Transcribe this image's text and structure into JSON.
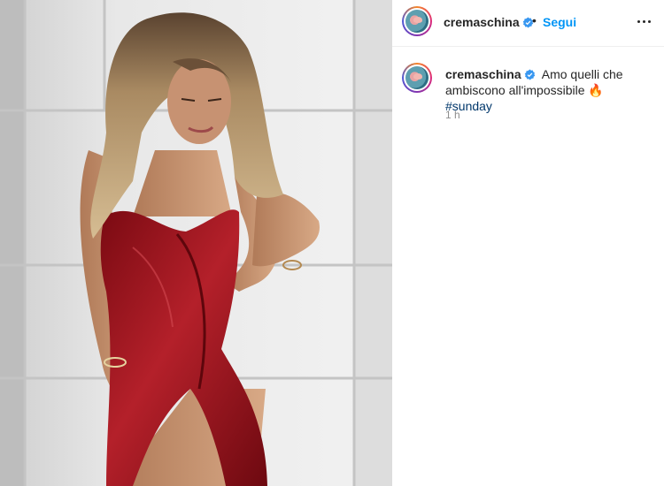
{
  "post": {
    "username": "cremaschina",
    "separator": "•",
    "follow_label": "Segui",
    "more_icon": "more-horizontal-icon",
    "verified_icon": "verified-badge-icon",
    "caption_text": "Amo quelli che ambiscono all'impossibile 🔥 ",
    "hashtag": "#sunday",
    "timestamp": "1 h"
  },
  "colors": {
    "follow_blue": "#0095f6",
    "verified_blue": "#3897f0",
    "hashtag": "#00376b",
    "dress_red": "#a5121c"
  }
}
